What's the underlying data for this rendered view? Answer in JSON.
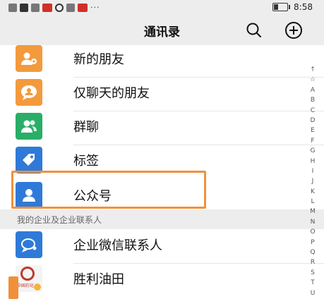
{
  "status_bar": {
    "time": "8:58",
    "overflow": "···"
  },
  "header": {
    "title": "通讯录",
    "search_icon": "search-icon",
    "add_icon": "add-circle-icon"
  },
  "items": [
    {
      "label": "新的朋友",
      "icon": "add-friend-icon",
      "color": "#f39a3d"
    },
    {
      "label": "仅聊天的朋友",
      "icon": "chat-face-icon",
      "color": "#f39a3d"
    },
    {
      "label": "群聊",
      "icon": "group-icon",
      "color": "#2aae67"
    },
    {
      "label": "标签",
      "icon": "tag-icon",
      "color": "#2f7ad9"
    },
    {
      "label": "公众号",
      "icon": "official-account-icon",
      "color": "#2f7ad9"
    }
  ],
  "section": {
    "title": "我的企业及企业联系人"
  },
  "enterprise_items": [
    {
      "label": "企业微信联系人",
      "icon": "wecom-icon",
      "color": "#2f7ad9"
    },
    {
      "label": "胜利油田",
      "icon": "sinopec-logo"
    }
  ],
  "logo_text": "中国石化",
  "index_letters": [
    "↑",
    "☆",
    "A",
    "B",
    "C",
    "D",
    "E",
    "F",
    "G",
    "H",
    "I",
    "J",
    "K",
    "L",
    "M",
    "N",
    "O",
    "P",
    "Q",
    "R",
    "S",
    "T",
    "U"
  ],
  "colors": {
    "highlight": "#f0913a",
    "background_gray": "#ededed"
  }
}
